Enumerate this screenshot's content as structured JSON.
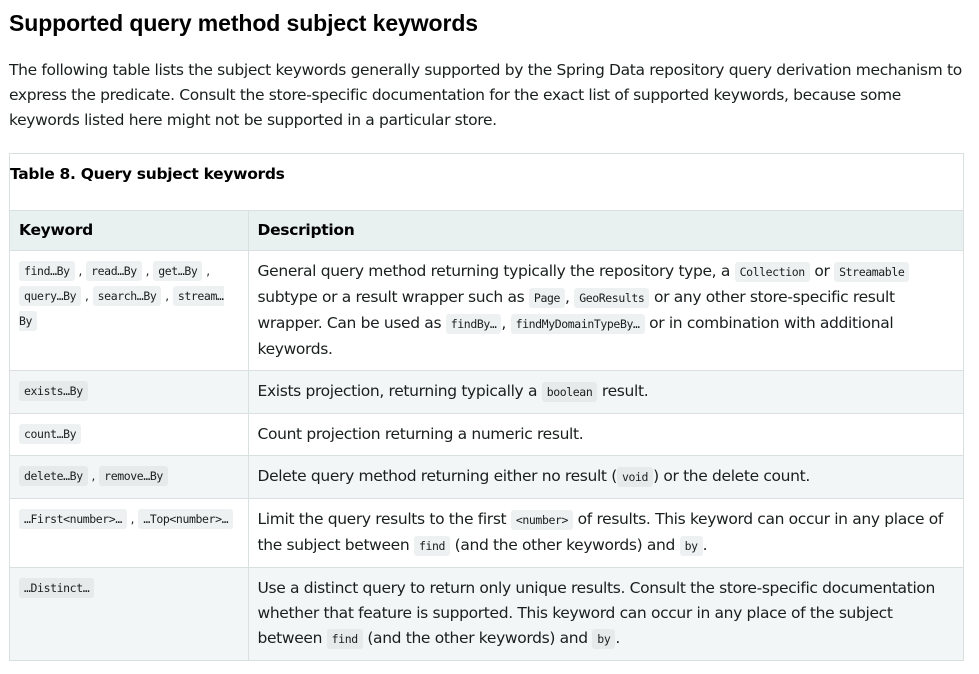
{
  "heading": "Supported query method subject keywords",
  "intro": "The following table lists the subject keywords generally supported by the Spring Data repository query derivation mechanism to express the predicate. Consult the store-specific documentation for the exact list of supported keywords, because some keywords listed here might not be supported in a particular store.",
  "table": {
    "caption": "Table 8. Query subject keywords",
    "headers": [
      "Keyword",
      "Description"
    ],
    "rows": [
      {
        "keywords": [
          "find…By",
          "read…By",
          "get…By",
          "query…By",
          "search…By",
          "stream…By"
        ],
        "description": [
          {
            "t": "General query method returning typically the repository type, a "
          },
          {
            "c": "Collection"
          },
          {
            "t": " or "
          },
          {
            "c": "Streamable"
          },
          {
            "t": " subtype or a result wrapper such as "
          },
          {
            "c": "Page"
          },
          {
            "t": ", "
          },
          {
            "c": "GeoResults"
          },
          {
            "t": " or any other store-specific result wrapper. Can be used as "
          },
          {
            "c": "findBy…"
          },
          {
            "t": ", "
          },
          {
            "c": "findMyDomainTypeBy…"
          },
          {
            "t": " or in combination with additional keywords."
          }
        ]
      },
      {
        "keywords": [
          "exists…By"
        ],
        "description": [
          {
            "t": "Exists projection, returning typically a "
          },
          {
            "c": "boolean"
          },
          {
            "t": " result."
          }
        ]
      },
      {
        "keywords": [
          "count…By"
        ],
        "description": [
          {
            "t": "Count projection returning a numeric result."
          }
        ]
      },
      {
        "keywords": [
          "delete…By",
          "remove…By"
        ],
        "description": [
          {
            "t": "Delete query method returning either no result ("
          },
          {
            "c": "void"
          },
          {
            "t": ") or the delete count."
          }
        ]
      },
      {
        "keywords": [
          "…First<number>…",
          "…Top<number>…"
        ],
        "description": [
          {
            "t": "Limit the query results to the first "
          },
          {
            "c": "<number>"
          },
          {
            "t": " of results. This keyword can occur in any place of the subject between "
          },
          {
            "c": "find"
          },
          {
            "t": " (and the other keywords) and "
          },
          {
            "c": "by"
          },
          {
            "t": "."
          }
        ]
      },
      {
        "keywords": [
          "…Distinct…"
        ],
        "description": [
          {
            "t": "Use a distinct query to return only unique results. Consult the store-specific documentation whether that feature is supported. This keyword can occur in any place of the subject between "
          },
          {
            "c": "find"
          },
          {
            "t": " (and the other keywords) and "
          },
          {
            "c": "by"
          },
          {
            "t": "."
          }
        ]
      }
    ]
  }
}
